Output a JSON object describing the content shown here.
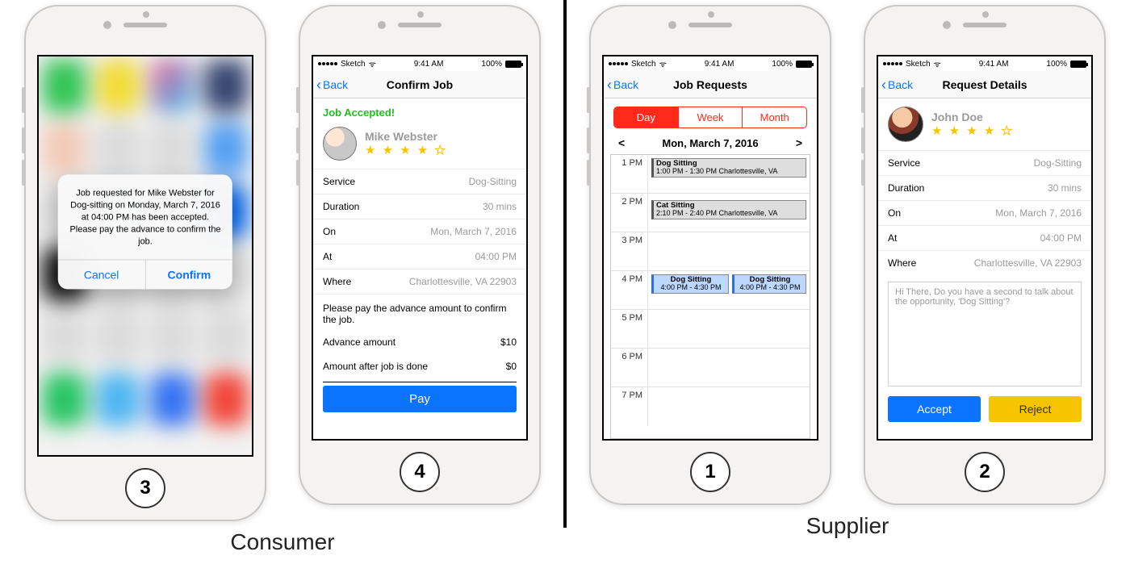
{
  "sections": {
    "consumer": "Consumer",
    "supplier": "Supplier"
  },
  "step_numbers": {
    "p3": "3",
    "p4": "4",
    "p1": "1",
    "p2": "2"
  },
  "status": {
    "carrier": "Sketch",
    "time": "9:41 AM",
    "battery": "100%",
    "back": "Back",
    "wifi_glyph": "▲"
  },
  "phone3": {
    "alert_text": "Job requested for Mike Webster for Dog-sitting on Monday, March 7, 2016 at 04:00 PM has been accepted. Please pay the advance to confirm the job.",
    "cancel": "Cancel",
    "confirm": "Confirm"
  },
  "phone4": {
    "title": "Confirm Job",
    "accepted": "Job Accepted!",
    "name": "Mike Webster",
    "stars": 4,
    "rows": {
      "service": {
        "k": "Service",
        "v": "Dog-Sitting"
      },
      "duration": {
        "k": "Duration",
        "v": "30 mins"
      },
      "on": {
        "k": "On",
        "v": "Mon, March 7, 2016"
      },
      "at": {
        "k": "At",
        "v": "04:00 PM"
      },
      "where": {
        "k": "Where",
        "v": "Charlottesville, VA 22903"
      }
    },
    "instruction": "Please pay the advance amount to confirm the job.",
    "advance": {
      "k": "Advance amount",
      "v": "$10"
    },
    "after": {
      "k": "Amount after job is done",
      "v": "$0"
    },
    "pay": "Pay"
  },
  "phone1": {
    "title": "Job Requests",
    "seg": {
      "day": "Day",
      "week": "Week",
      "month": "Month",
      "active": "day"
    },
    "date": "Mon, March 7, 2016",
    "hours": [
      "1 PM",
      "2 PM",
      "3 PM",
      "4 PM",
      "5 PM",
      "6 PM",
      "7 PM"
    ],
    "events": [
      {
        "hour": "1 PM",
        "title": "Dog Sitting",
        "detail": "1:00 PM - 1:30 PM Charlottesville, VA",
        "style": "grey"
      },
      {
        "hour": "2 PM",
        "title": "Cat Sitting",
        "detail": "2:10 PM - 2:40 PM Charlottesville, VA",
        "style": "grey"
      },
      {
        "hour": "4 PM",
        "title": "Dog Sitting",
        "detail": "4:00 PM - 4:30 PM",
        "style": "blue-left"
      },
      {
        "hour": "4 PM",
        "title": "Dog Sitting",
        "detail": "4:00 PM - 4:30 PM",
        "style": "blue-right"
      }
    ]
  },
  "phone2": {
    "title": "Request Details",
    "name": "John Doe",
    "stars": 4,
    "rows": {
      "service": {
        "k": "Service",
        "v": "Dog-Sitting"
      },
      "duration": {
        "k": "Duration",
        "v": "30 mins"
      },
      "on": {
        "k": "On",
        "v": "Mon, March 7, 2016"
      },
      "at": {
        "k": "At",
        "v": "04:00 PM"
      },
      "where": {
        "k": "Where",
        "v": "Charlottesville, VA 22903"
      }
    },
    "message": "Hi There, Do you have a second to talk about the                              opportunity, 'Dog Sitting'?",
    "accept": "Accept",
    "reject": "Reject"
  }
}
